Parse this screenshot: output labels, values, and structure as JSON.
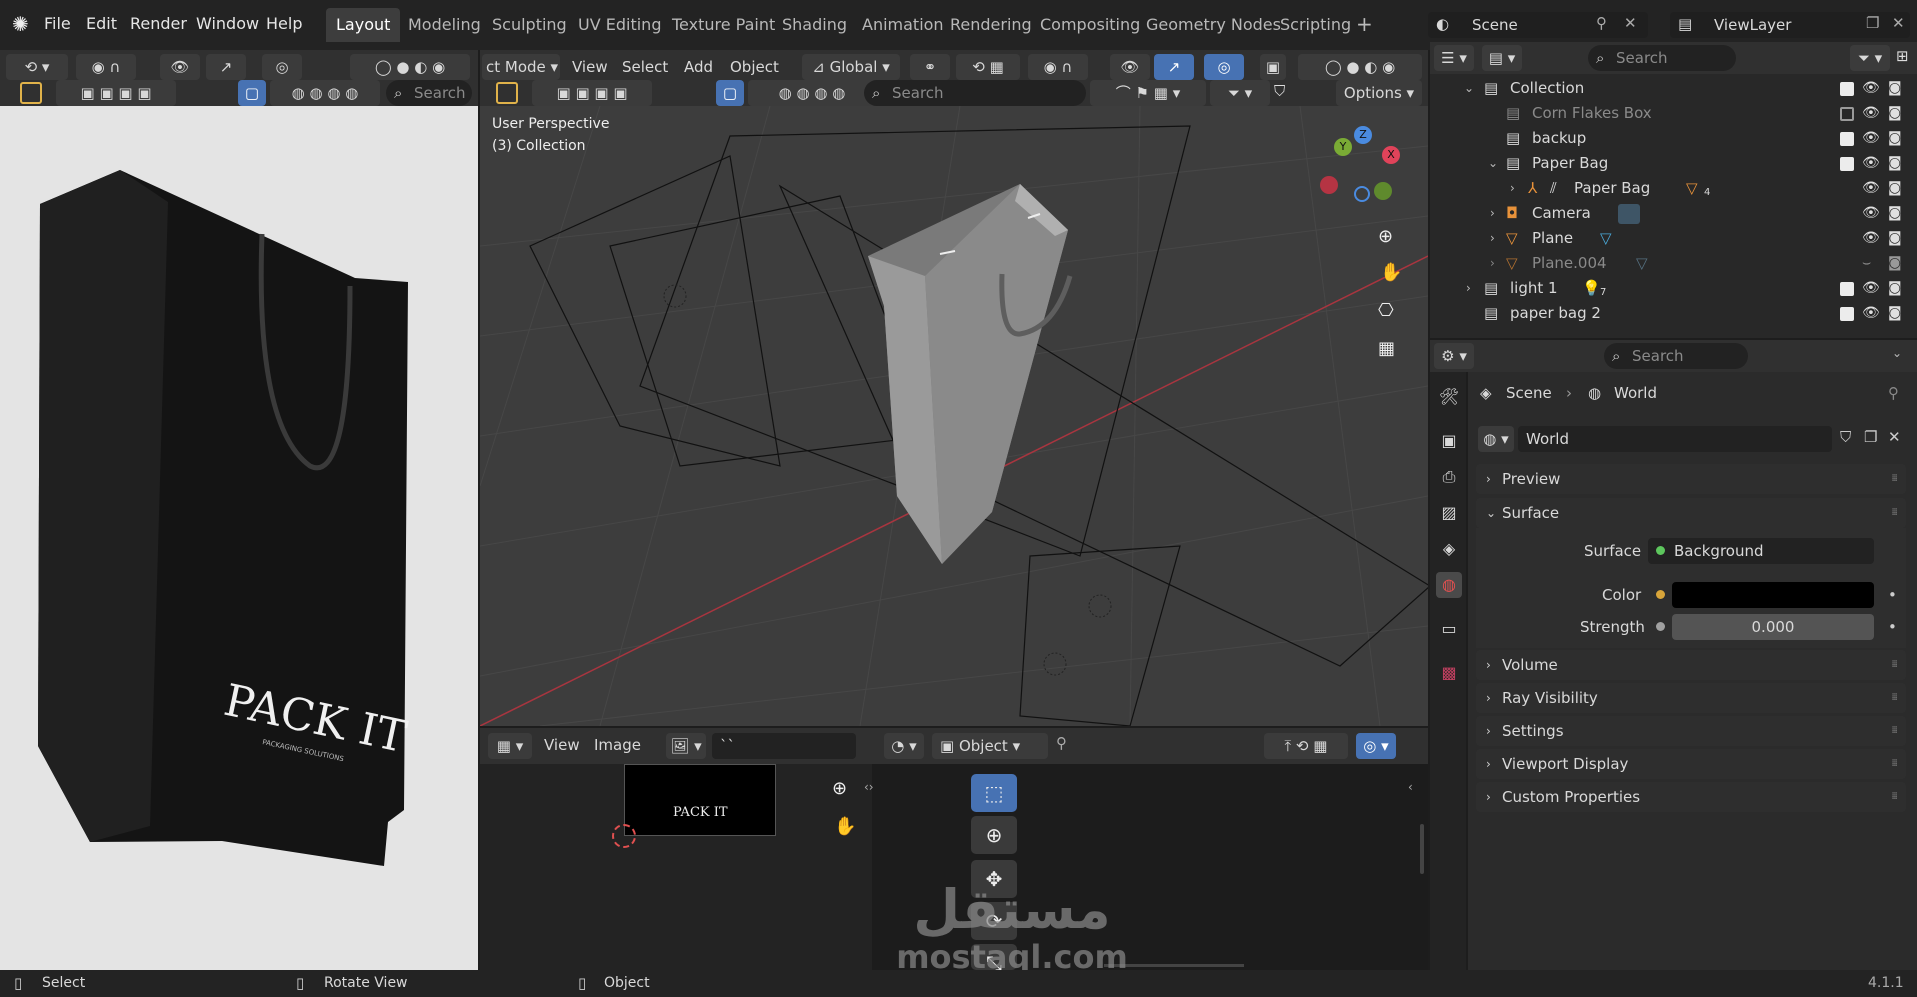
{
  "topbar": {
    "menus": [
      "File",
      "Edit",
      "Render",
      "Window",
      "Help"
    ],
    "workspaces": [
      "Layout",
      "Modeling",
      "Sculpting",
      "UV Editing",
      "Texture Paint",
      "Shading",
      "Animation",
      "Rendering",
      "Compositing",
      "Geometry Nodes",
      "Scripting"
    ],
    "active_workspace": "Layout",
    "scene_label": "Scene",
    "viewlayer_label": "ViewLayer"
  },
  "left_editor": {
    "search_placeholder": "Search",
    "brand_text": "PACK IT",
    "brand_sub": "PACKAGING SOLUTIONS"
  },
  "viewport": {
    "mode_label": "ct Mode",
    "menus": [
      "View",
      "Select",
      "Add",
      "Object"
    ],
    "transform_orientation": "Global",
    "options_label": "Options",
    "search_placeholder": "Search",
    "overlay_line1": "User Perspective",
    "overlay_line2": "(3) Collection",
    "gizmo": {
      "x": "X",
      "y": "Y",
      "z": "Z"
    }
  },
  "image_editor": {
    "menus": [
      "View",
      "Image"
    ],
    "image_name": "``",
    "preview_text": "PACK IT",
    "mode_label": "Object"
  },
  "outliner": {
    "search_placeholder": "Search",
    "rows": [
      {
        "name": "Collection",
        "indent": 0,
        "checked": true
      },
      {
        "name": "Corn Flakes Box",
        "indent": 1,
        "checked": false,
        "dim": true
      },
      {
        "name": "backup",
        "indent": 1,
        "checked": true
      },
      {
        "name": "Paper Bag",
        "indent": 1,
        "checked": true
      },
      {
        "name": "Paper Bag",
        "indent": 2,
        "badge": "4"
      },
      {
        "name": "Camera",
        "indent": 1
      },
      {
        "name": "Plane",
        "indent": 1
      },
      {
        "name": "Plane.004",
        "indent": 1,
        "dim": true
      },
      {
        "name": "light 1",
        "indent": 0,
        "checked": true,
        "badge": "7"
      },
      {
        "name": "paper bag 2",
        "indent": 0,
        "checked": true
      }
    ]
  },
  "properties": {
    "search_placeholder": "Search",
    "breadcrumb_scene": "Scene",
    "breadcrumb_world": "World",
    "world_name": "World",
    "panels": {
      "preview": "Preview",
      "surface": "Surface",
      "volume": "Volume",
      "ray_visibility": "Ray Visibility",
      "settings": "Settings",
      "viewport_display": "Viewport Display",
      "custom_properties": "Custom Properties"
    },
    "surface_label": "Surface",
    "surface_value": "Background",
    "color_label": "Color",
    "strength_label": "Strength",
    "strength_value": "0.000"
  },
  "statusbar": {
    "select": "Select",
    "rotate_view": "Rotate View",
    "object": "Object",
    "version": "4.1.1"
  },
  "watermark": {
    "arabic": "مستقل",
    "latin": "mostaql.com"
  },
  "colors": {
    "accent_blue": "#4772b3",
    "header": "#303030",
    "viewport_bg": "#3d3d3d",
    "panel_bg": "#2b2b2b",
    "axis_red": "#c0394d"
  }
}
